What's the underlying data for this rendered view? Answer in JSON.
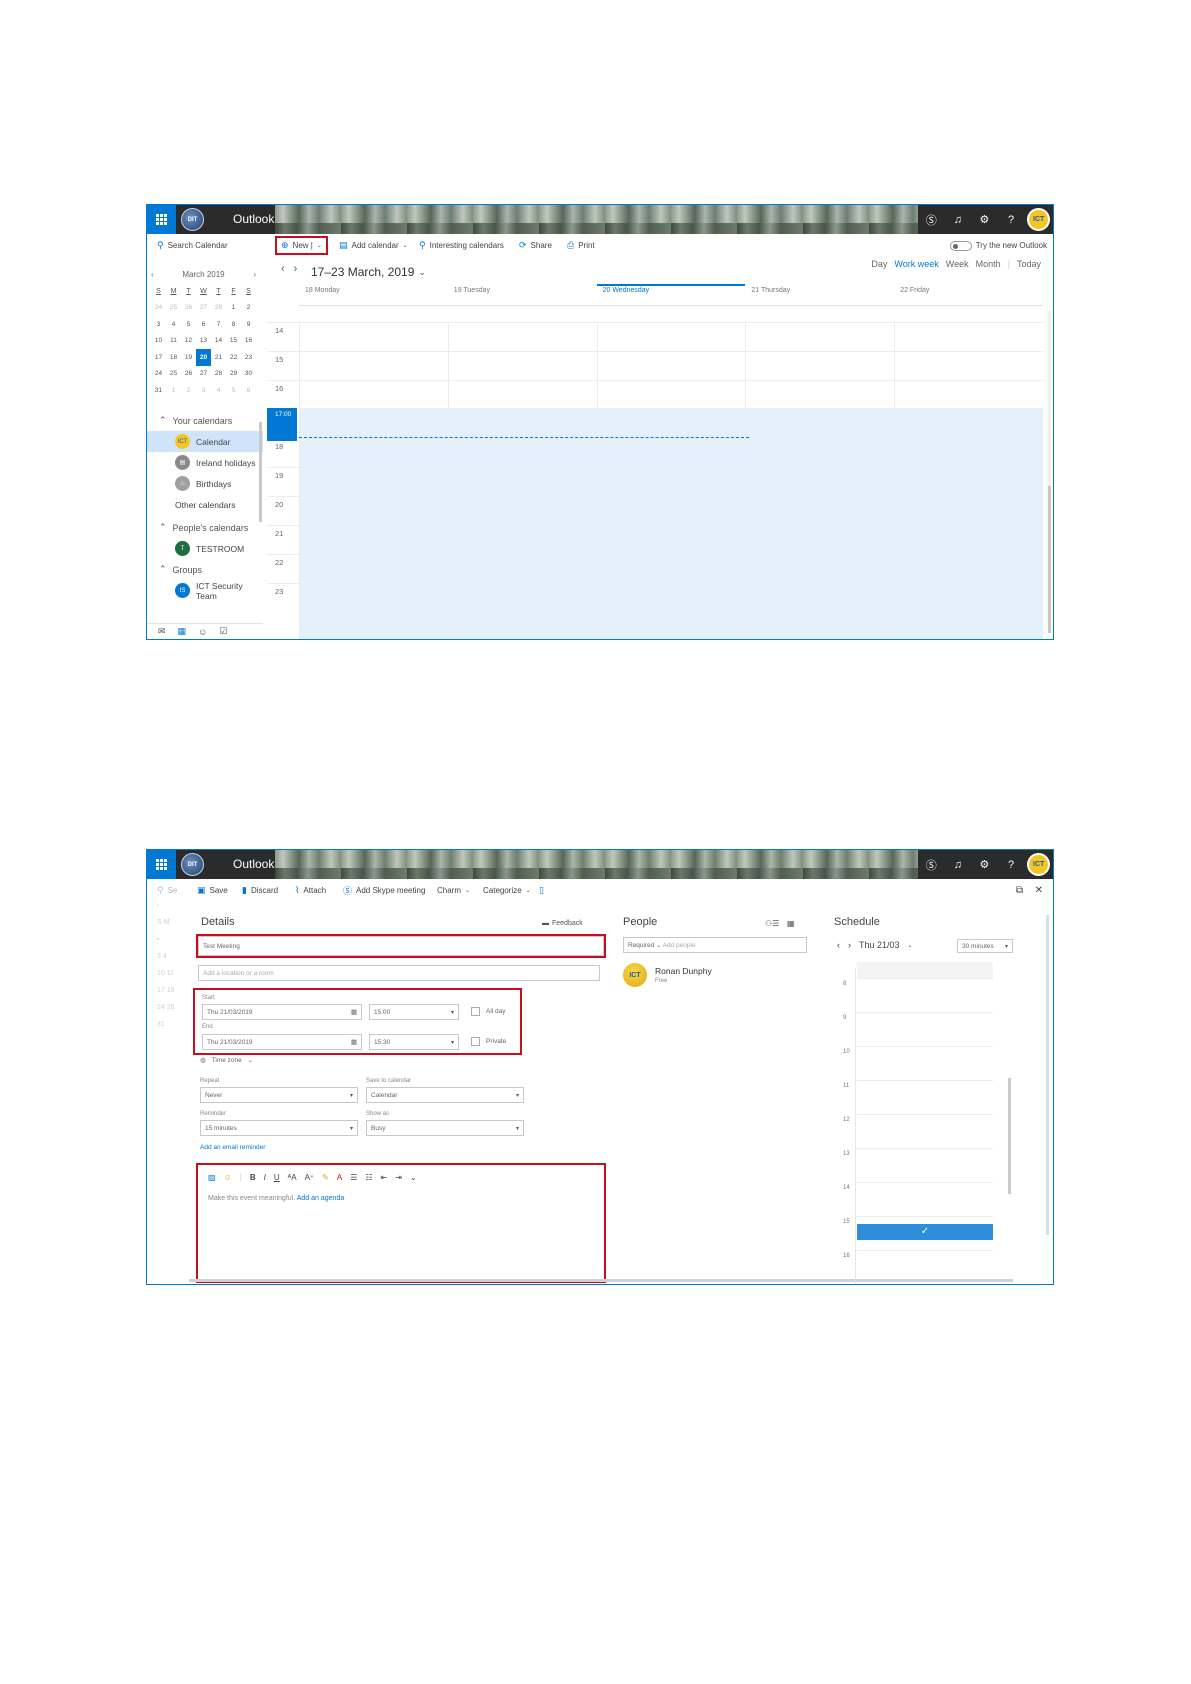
{
  "shared": {
    "app_name": "Outlook",
    "logo_text": "DIT",
    "avatar_text": "ICT",
    "header_icons": {
      "skype": "Ⓢ",
      "bell": "♫",
      "gear": "⚙",
      "help": "?"
    }
  },
  "calendar_view": {
    "search_placeholder": "Search Calendar",
    "toolbar": {
      "new_label": "New |",
      "add_calendar": "Add calendar",
      "interesting": "Interesting calendars",
      "share": "Share",
      "print": "Print",
      "try_new": "Try the new Outlook"
    },
    "mini_calendar": {
      "month": "March 2019",
      "weekdays": [
        "S",
        "M",
        "T",
        "W",
        "T",
        "F",
        "S"
      ],
      "weeks": [
        [
          "24",
          "25",
          "26",
          "27",
          "28",
          "1",
          "2"
        ],
        [
          "3",
          "4",
          "5",
          "6",
          "7",
          "8",
          "9"
        ],
        [
          "10",
          "11",
          "12",
          "13",
          "14",
          "15",
          "16"
        ],
        [
          "17",
          "18",
          "19",
          "20",
          "21",
          "22",
          "23"
        ],
        [
          "24",
          "25",
          "26",
          "27",
          "28",
          "29",
          "30"
        ],
        [
          "31",
          "1",
          "2",
          "3",
          "4",
          "5",
          "6"
        ]
      ],
      "selected": "20"
    },
    "nav": {
      "your_calendars": "Your calendars",
      "calendar": "Calendar",
      "ireland_holidays": "Ireland holidays",
      "birthdays": "Birthdays",
      "other_calendars": "Other calendars",
      "peoples_calendars": "People's calendars",
      "testroom": "TESTROOM",
      "testroom_initial": "T",
      "groups": "Groups",
      "ict_team": "ICT Security Team",
      "ict_team_initial": "IS"
    },
    "range_title": "17–23 March, 2019",
    "views": {
      "day": "Day",
      "work_week": "Work week",
      "week": "Week",
      "month": "Month",
      "today": "Today"
    },
    "days": [
      "18 Monday",
      "19 Tuesday",
      "20 Wednesday",
      "21 Thursday",
      "22 Friday"
    ],
    "hours": [
      "14",
      "15",
      "16",
      "17",
      "18",
      "19",
      "20",
      "21",
      "22",
      "23"
    ],
    "now_label": "17:00"
  },
  "event_form": {
    "toolbar": {
      "search_stub": "Se",
      "save": "Save",
      "discard": "Discard",
      "attach": "Attach",
      "skype": "Add Skype meeting",
      "charm": "Charm",
      "categorize": "Categorize"
    },
    "details_title": "Details",
    "feedback": "Feedback",
    "title_value": "Test Meeting",
    "location_placeholder": "Add a location or a room",
    "start_label": "Start",
    "start_date": "Thu 21/03/2019",
    "start_time": "15:00",
    "all_day": "All day",
    "end_label": "End",
    "end_date": "Thu 21/03/2019",
    "end_time": "15:30",
    "private": "Private",
    "time_zone": "Time zone",
    "repeat_label": "Repeat",
    "repeat_value": "Never",
    "save_to_label": "Save to calendar",
    "save_to_value": "Calendar",
    "reminder_label": "Reminder",
    "reminder_value": "15 minutes",
    "show_as_label": "Show as",
    "show_as_value": "Busy",
    "email_reminder": "Add an email reminder",
    "body_placeholder": "Make this event meaningful.",
    "add_agenda": "Add an agenda",
    "people_title": "People",
    "required": "Required",
    "add_people": "Add people",
    "attendee_name": "Ronan Dunphy",
    "attendee_status": "Free",
    "schedule_title": "Schedule",
    "schedule_date": "Thu 21/03",
    "interval": "30 minutes",
    "schedule_hours": [
      "8",
      "9",
      "10",
      "11",
      "12",
      "13",
      "14",
      "15",
      "16"
    ]
  }
}
